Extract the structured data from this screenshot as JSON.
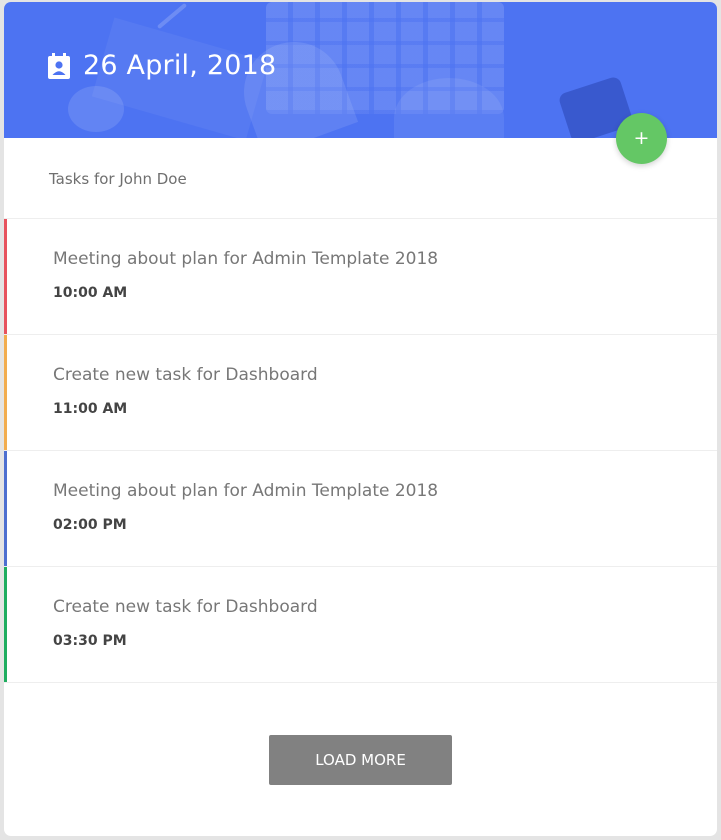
{
  "header": {
    "date": "26 April, 2018",
    "calendar_icon": "calendar-icon",
    "background_color": "#4d73f2"
  },
  "add_button": {
    "label": "+",
    "color": "#64c765"
  },
  "subtitle": "Tasks for John Doe",
  "tasks": [
    {
      "title": "Meeting about plan for Admin Template 2018",
      "time": "10:00 AM",
      "color": "#e7535e"
    },
    {
      "title": "Create new task for Dashboard",
      "time": "11:00 AM",
      "color": "#f2ad4e"
    },
    {
      "title": "Meeting about plan for Admin Template 2018",
      "time": "02:00 PM",
      "color": "#4d6fd0"
    },
    {
      "title": "Create new task for Dashboard",
      "time": "03:30 PM",
      "color": "#1fad5f"
    }
  ],
  "load_more": {
    "label": "LOAD MORE",
    "color": "#818181"
  }
}
